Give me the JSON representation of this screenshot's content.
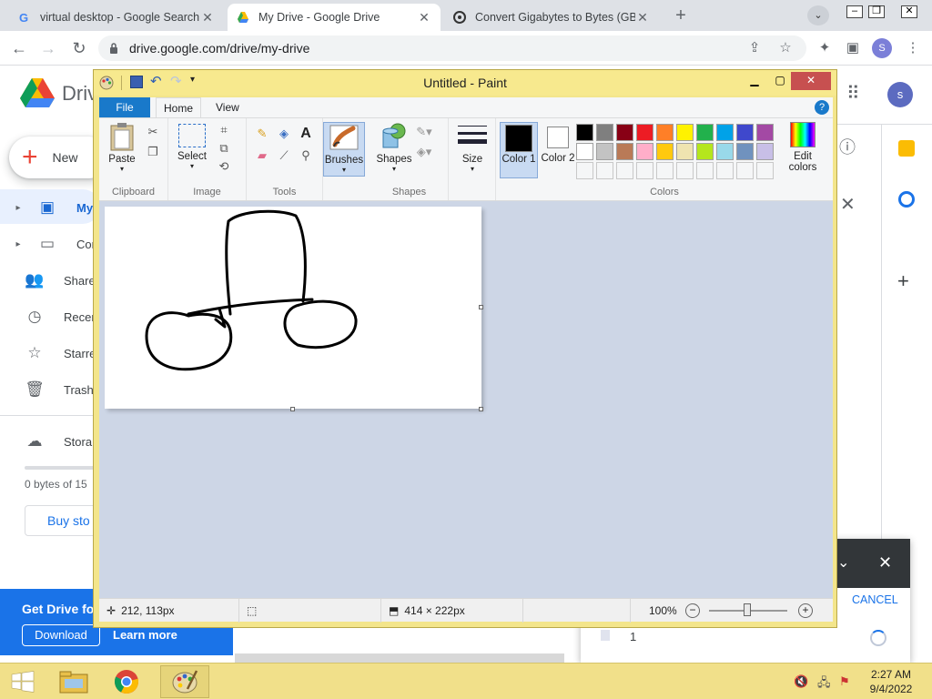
{
  "tabs": [
    {
      "title": "virtual desktop - Google Search"
    },
    {
      "title": "My Drive - Google Drive"
    },
    {
      "title": "Convert Gigabytes to Bytes (GB"
    }
  ],
  "url": "drive.google.com/drive/my-drive",
  "profile_initial": "S",
  "drive": {
    "logo_text": "Driv",
    "new_label": "New",
    "nav": [
      "My Dr",
      "Comp",
      "Share",
      "Recer",
      "Starre",
      "Trash",
      "Stora"
    ],
    "storage_text": "0 bytes of 15",
    "buy_label": "Buy sto",
    "promo_text": "Get Drive fo",
    "download_label": "Download",
    "learn_label": "Learn more",
    "avatar": "s",
    "upload_cancel": "CANCEL",
    "upload_count": "1"
  },
  "paint": {
    "title": "Untitled - Paint",
    "tabs": {
      "file": "File",
      "home": "Home",
      "view": "View"
    },
    "groups": {
      "clipboard": "Clipboard",
      "image": "Image",
      "tools": "Tools",
      "shapes": "Shapes",
      "colors": "Colors"
    },
    "buttons": {
      "paste": "Paste",
      "select": "Select",
      "brushes": "Brushes",
      "shapes": "Shapes",
      "size": "Size",
      "color1": "Color 1",
      "color2": "Color 2",
      "edit_colors": "Edit colors"
    },
    "palette_row1": [
      "#000000",
      "#7f7f7f",
      "#880015",
      "#ed1c24",
      "#ff7f27",
      "#fff200",
      "#22b14c",
      "#00a2e8",
      "#3f48cc",
      "#a349a4"
    ],
    "palette_row2": [
      "#ffffff",
      "#c3c3c3",
      "#b97a57",
      "#ffaec9",
      "#ffc90e",
      "#efe4b0",
      "#b5e61d",
      "#99d9ea",
      "#7092be",
      "#c8bfe7"
    ],
    "status": {
      "cursor": "212, 113px",
      "size": "414 × 222px",
      "zoom": "100%"
    }
  },
  "taskbar": {
    "time": "2:27 AM",
    "date": "9/4/2022"
  }
}
